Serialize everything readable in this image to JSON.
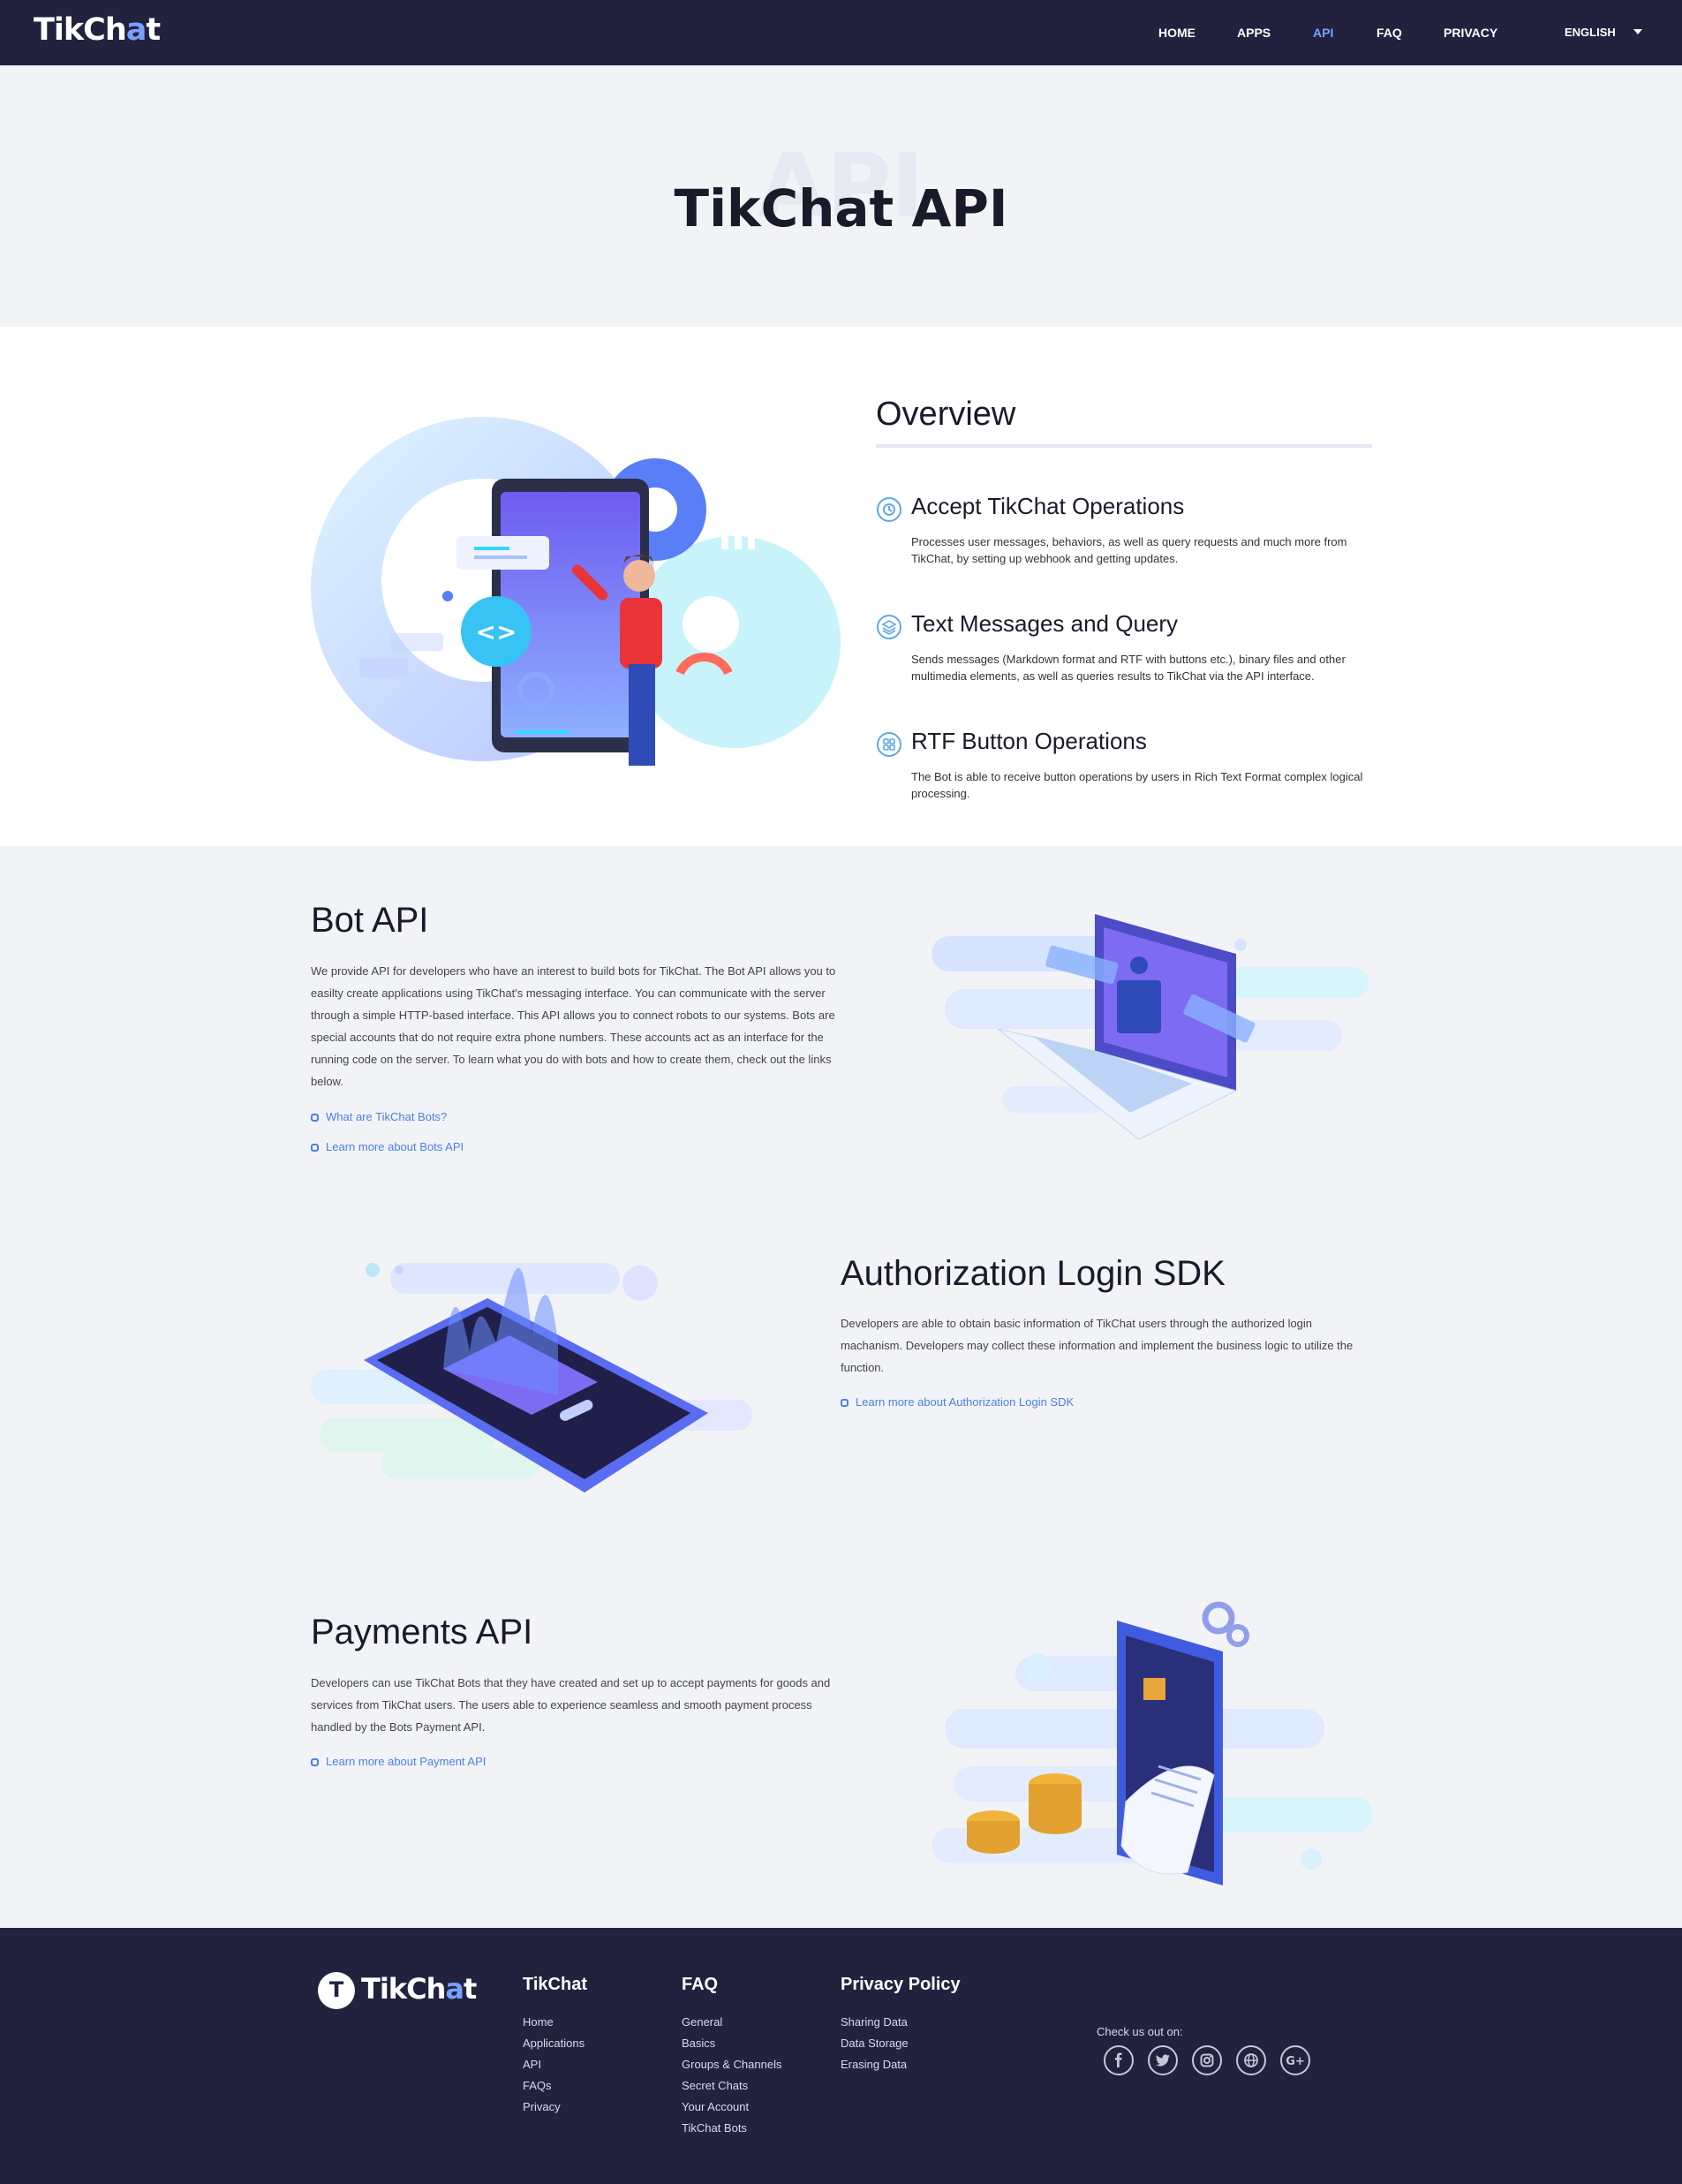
{
  "nav": {
    "logo": "TikChat",
    "links": [
      "HOME",
      "APPS",
      "API",
      "FAQ",
      "PRIVACY"
    ],
    "active": "API",
    "language": "ENGLISH"
  },
  "hero": {
    "ghost": "API",
    "title": "TikChat API"
  },
  "overview": {
    "title": "Overview",
    "features": [
      {
        "icon": "clock-shield-icon",
        "title": "Accept TikChat Operations",
        "text": "Processes user messages, behaviors, as well as query requests and much more from TikChat, by setting up webhook and getting updates."
      },
      {
        "icon": "layers-icon",
        "title": "Text Messages and Query",
        "text": "Sends messages (Markdown format and RTF with buttons etc.), binary files and other multimedia elements, as well as queries results to TikChat via the API interface."
      },
      {
        "icon": "grid-icon",
        "title": "RTF Button Operations",
        "text": "The Bot is able to receive button operations by users in Rich Text Format complex logical processing."
      }
    ]
  },
  "bot_api": {
    "title": "Bot API",
    "body": "We provide API for developers who have an interest to build bots for TikChat. The Bot API allows you to easilty create applications using TikChat's messaging interface. You can communicate with the server through a simple HTTP-based interface. This API allows you to connect robots to our systems. Bots are special accounts that do not require extra phone numbers. These accounts act as an interface for the running code on the server. To learn what you do with bots and how to create them, check out the links below.",
    "links": [
      "What are TikChat Bots?",
      "Learn more about Bots API"
    ]
  },
  "auth_sdk": {
    "title": "Authorization Login SDK",
    "body": "Developers are able to obtain basic information of TikChat users through the authorized login machanism. Developers may collect these information and implement the business logic to utilize the function.",
    "link": "Learn more about Authorization Login SDK"
  },
  "payments": {
    "title": "Payments API",
    "body": "Developers can use TikChat Bots that they have created and set up to accept payments for goods and services from TikChat users. The users able to experience seamless and smooth payment process handled by the Bots Payment API.",
    "link": "Learn more about Payment API"
  },
  "footer": {
    "logo_badge": "T",
    "logo": "TikChat",
    "columns": [
      {
        "title": "TikChat",
        "links": [
          "Home",
          "Applications",
          "API",
          "FAQs",
          "Privacy"
        ]
      },
      {
        "title": "FAQ",
        "links": [
          "General",
          "Basics",
          "Groups & Channels",
          "Secret Chats",
          "Your Account",
          "TikChat Bots"
        ]
      },
      {
        "title": "Privacy Policy",
        "links": [
          "Sharing Data",
          "Data Storage",
          "Erasing Data"
        ]
      }
    ],
    "check_us": "Check us out on:",
    "social": [
      "facebook-icon",
      "twitter-icon",
      "instagram-icon",
      "globe-icon",
      "google-plus-icon"
    ]
  }
}
